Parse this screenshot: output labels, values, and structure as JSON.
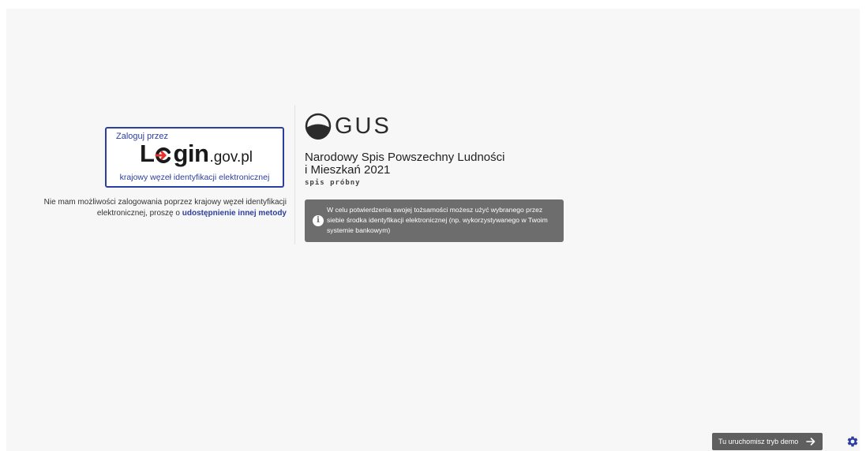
{
  "login": {
    "prompt": "Zaloguj przez",
    "logo_big_l": "L",
    "logo_big_rest": "gin",
    "logo_small": ".gov.pl",
    "subtitle": "krajowy węzeł identyfikacji elektronicznej"
  },
  "alternative": {
    "text": "Nie mam możliwości zalogowania poprzez krajowy węzeł identyfikacji elektronicznej, proszę o ",
    "link": "udostępnienie innej metody"
  },
  "brand": {
    "gus": "GUS",
    "title_line1": "Narodowy Spis Powszechny Ludności",
    "title_line2": "i Mieszkań 2021",
    "subtitle": "spis próbny"
  },
  "info": {
    "icon": "info-icon",
    "text": "W celu potwierdzenia swojej tożsamości możesz użyć wybranego przez siebie środka identyfikacji elektronicznej (np. wykorzystywanego w Twoim systemie bankowym)"
  },
  "footer": {
    "demo_label": "Tu uruchomisz tryb demo",
    "demo_icon": "arrow-right-icon",
    "settings_icon": "gear-icon"
  },
  "colors": {
    "accent": "#2c3e9e",
    "info_bg": "#6d6d6d",
    "demo_bg": "#5f5f5f",
    "logo_arrow": "#e5322d"
  }
}
